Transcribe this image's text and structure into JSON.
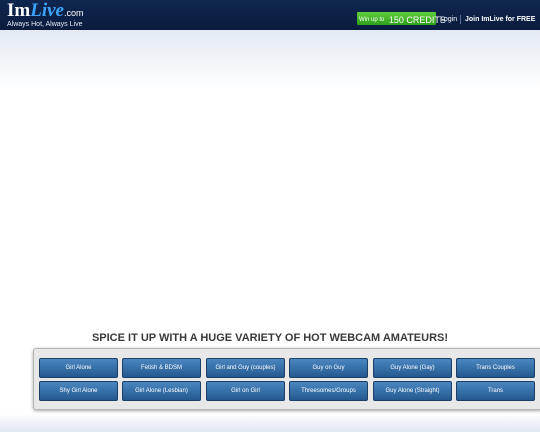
{
  "header": {
    "logo": {
      "im": "Im",
      "live": "Live",
      "com": ".com",
      "tagline": "Always Hot, Always Live"
    },
    "credits": {
      "prefix": "Win up to",
      "amount": "150 CREDITS"
    },
    "login_label": "Login",
    "join_label": "Join ImLive for FREE"
  },
  "main": {
    "headline": "SPICE IT UP WITH A HUGE VARIETY OF HOT WEBCAM AMATEURS!",
    "categories_row1": [
      "Girl Alone",
      "Fetish & BDSM",
      "Girl and Guy (couples)",
      "Guy on Guy",
      "Guy Alone (Gay)",
      "Trans Couples"
    ],
    "categories_row2": [
      "Shy Girl Alone",
      "Girl Alone (Lesbian)",
      "Girl on Girl",
      "Threesomes/Groups",
      "Guy Alone (Straight)",
      "Trans"
    ]
  },
  "colors": {
    "header_bg": "#0f2650",
    "accent_live": "#3da4ff",
    "credits_green": "#3fb02a",
    "category_button": "#2f6aa3"
  }
}
